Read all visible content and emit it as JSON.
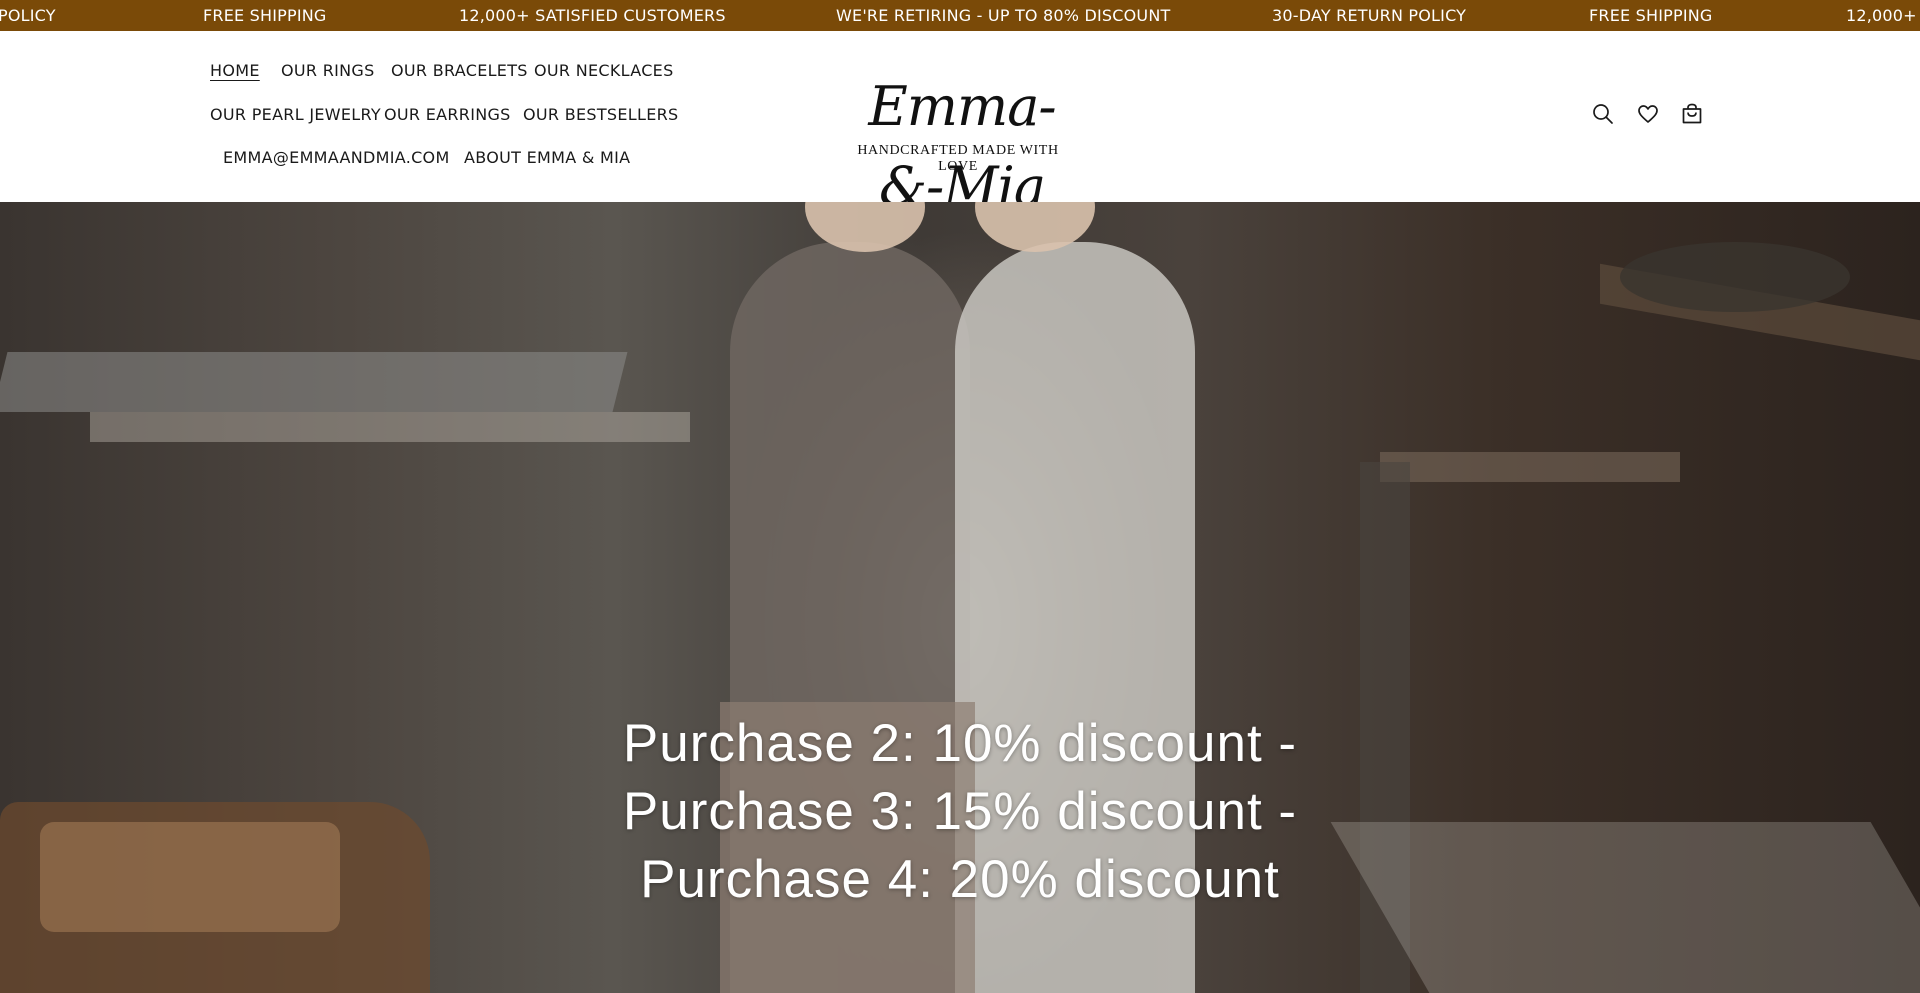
{
  "announcement": {
    "items": [
      "POLICY",
      "FREE SHIPPING",
      "12,000+ SATISFIED CUSTOMERS",
      "WE'RE RETIRING - UP TO 80% DISCOUNT",
      "30-DAY RETURN POLICY",
      "FREE SHIPPING",
      "12,000+ S..."
    ],
    "color": "#7a4a08"
  },
  "nav": {
    "home": "HOME",
    "rings": "OUR RINGS",
    "bracelets": "OUR BRACELETS",
    "necklaces": "OUR NECKLACES",
    "pearl": "OUR PEARL JEWELRY",
    "earrings": "OUR EARRINGS",
    "bestsellers": "OUR BESTSELLERS",
    "email": "EMMA@EMMAANDMIA.COM",
    "about": "ABOUT EMMA & MIA"
  },
  "logo": {
    "script": "Emma-&-Mia",
    "tagline": "HANDCRAFTED MADE WITH LOVE"
  },
  "header_icons": [
    "search-icon",
    "heart-icon",
    "cart-icon"
  ],
  "hero": {
    "line1": "Purchase 2: 10% discount -",
    "line2": "Purchase 3: 15% discount -",
    "line3": "Purchase 4: 20% discount"
  }
}
